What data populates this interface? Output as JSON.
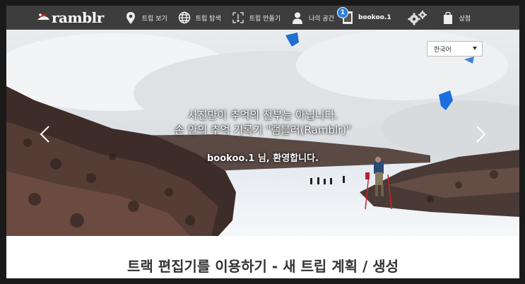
{
  "nav": {
    "logo_text": "ramblr",
    "items": [
      {
        "label": "트립 보기",
        "icon": "map-pin-icon"
      },
      {
        "label": "트립 탐색",
        "icon": "globe-icon"
      },
      {
        "label": "트립 만들기",
        "icon": "create-trip-icon"
      },
      {
        "label": "나의 공간",
        "icon": "user-icon"
      }
    ],
    "user": {
      "name": "bookoo.1",
      "badge": "1"
    },
    "settings_icon": "gears-icon",
    "shop_label": "상점",
    "shop_icon": "shopping-bag-icon"
  },
  "hero": {
    "language": "한국어",
    "line1": "사진만이 추억의 전부는 아닙니다.",
    "line2": "손 안의 추억 기록기 \"램블러(Ramblr)\"",
    "welcome": "bookoo.1 님, 환영합니다."
  },
  "section": {
    "title": "트랙 편집기를 이용하기 - 새 트립 계획 / 생성"
  },
  "colors": {
    "nav_bg": "#3d3d3d",
    "badge": "#2e7fd6",
    "page_bg": "#1a1a1a"
  }
}
